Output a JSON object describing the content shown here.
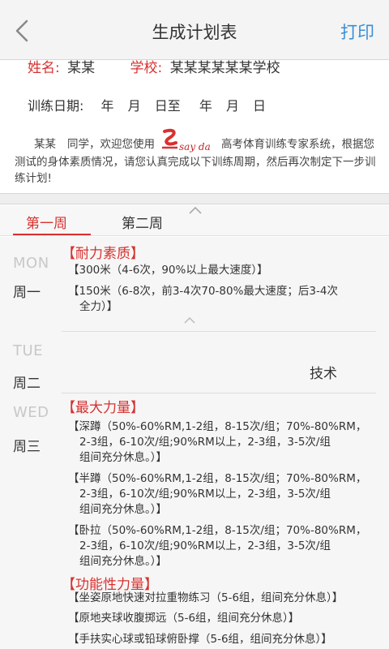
{
  "navbar": {
    "title": "生成计划表",
    "print_label": "打印"
  },
  "info": {
    "name_label": "姓名:",
    "name_value": "某某",
    "school_label": "学校:",
    "school_value": "某某某某某某学校",
    "dates_label": "训练日期:",
    "dates": [
      "年",
      "月",
      "日至",
      "年",
      "月",
      "日"
    ],
    "intro_name": "某某",
    "intro_line_a": "同学，欢迎您使用",
    "intro_line_b": "高考体育训练专家系统",
    "intro_line_c": "，根据您测试的身体素质情况，请您认真完成以下训练周期，然后再次制定下一步训练计划!",
    "logo_text": "say da"
  },
  "tabs": [
    {
      "label": "第一周"
    },
    {
      "label": "第二周"
    }
  ],
  "days": [
    {
      "en": "MON",
      "cn": "周一"
    },
    {
      "en": "TUE",
      "cn": "周二"
    },
    {
      "en": "WED",
      "cn": "周三"
    }
  ],
  "mon": {
    "category": "【耐力素质】",
    "items": [
      "【300米（4-6次，90%以上最大速度）】",
      "【150米（6-8次，前3-4次70-80%最大速度；后3-4次",
      "全力）】"
    ]
  },
  "tue": {
    "label": "技术"
  },
  "wed": {
    "category1": "【最大力量】",
    "items1": [
      "【深蹲（50%-60%RM,1-2组，8-15次/组；70%-80%RM，",
      "2-3组，6-10次/组;90%RM以上，2-3组，3-5次/组",
      "组间充分休息。）】",
      "【半蹲（50%-60%RM,1-2组，8-15次/组；70%-80%RM，",
      "2-3组，6-10次/组;90%RM以上，2-3组，3-5次/组",
      "组间充分休息。）】",
      "【卧拉（50%-60%RM,1-2组，8-15次/组；70%-80%RM，",
      "2-3组，6-10次/组;90%RM以上，2-3组，3-5次/组",
      "组间充分休息。）】"
    ],
    "category2": "【功能性力量】",
    "items2": [
      "【坐姿原地快速对拉重物练习（5-6组，组间充分休息）】",
      "【原地夹球收腹掷远（5-6组，组间充分休息）】",
      "【手扶实心球或铅球俯卧撑（5-6组，组间充分休息）】"
    ]
  },
  "colors": {
    "accent": "#d8312f",
    "link": "#3b8fd6"
  }
}
